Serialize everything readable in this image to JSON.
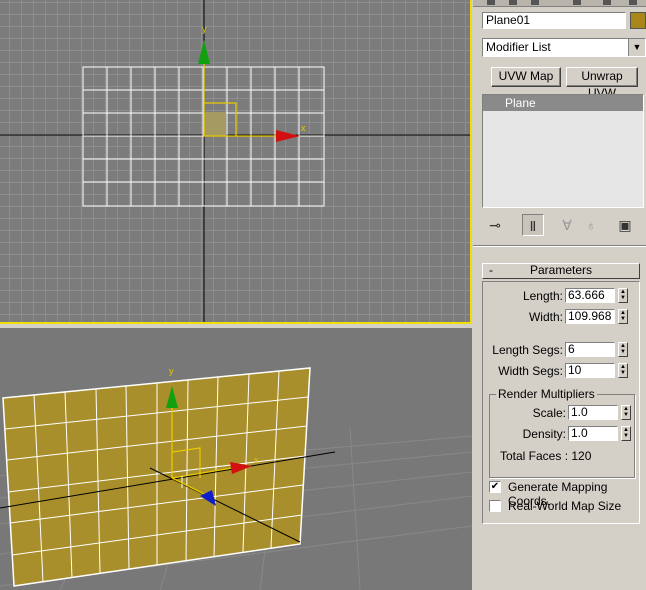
{
  "viewports": {
    "top": {
      "x_axis_label": "x",
      "y_axis_label": "y"
    },
    "perspective": {
      "x_axis_label": "x",
      "y_axis_label": "y"
    }
  },
  "panel": {
    "object_name": "Plane01",
    "object_color": "#a8861a",
    "modifier_list": "Modifier List",
    "buttons": {
      "uvw_map": "UVW Map",
      "unwrap_uvw": "Unwrap UVW"
    },
    "stack_items": [
      "Plane"
    ],
    "tools": [
      "pin-stack-icon",
      "show-end-result-icon",
      "make-unique-icon",
      "remove-modifier-icon",
      "configure-sets-icon"
    ]
  },
  "parameters": {
    "title": "Parameters",
    "collapse": "-",
    "length_label": "Length:",
    "length_value": "63.666",
    "width_label": "Width:",
    "width_value": "109.968",
    "length_segs_label": "Length Segs:",
    "length_segs_value": "6",
    "width_segs_label": "Width Segs:",
    "width_segs_value": "10",
    "render_multipliers": "Render Multipliers",
    "scale_label": "Scale:",
    "scale_value": "1.0",
    "density_label": "Density:",
    "density_value": "1.0",
    "total_faces": "Total Faces : 120",
    "generate_mapping_label": "Generate Mapping Coords.",
    "generate_mapping_checked": true,
    "real_world_label": "Real-World Map Size",
    "real_world_checked": false
  }
}
